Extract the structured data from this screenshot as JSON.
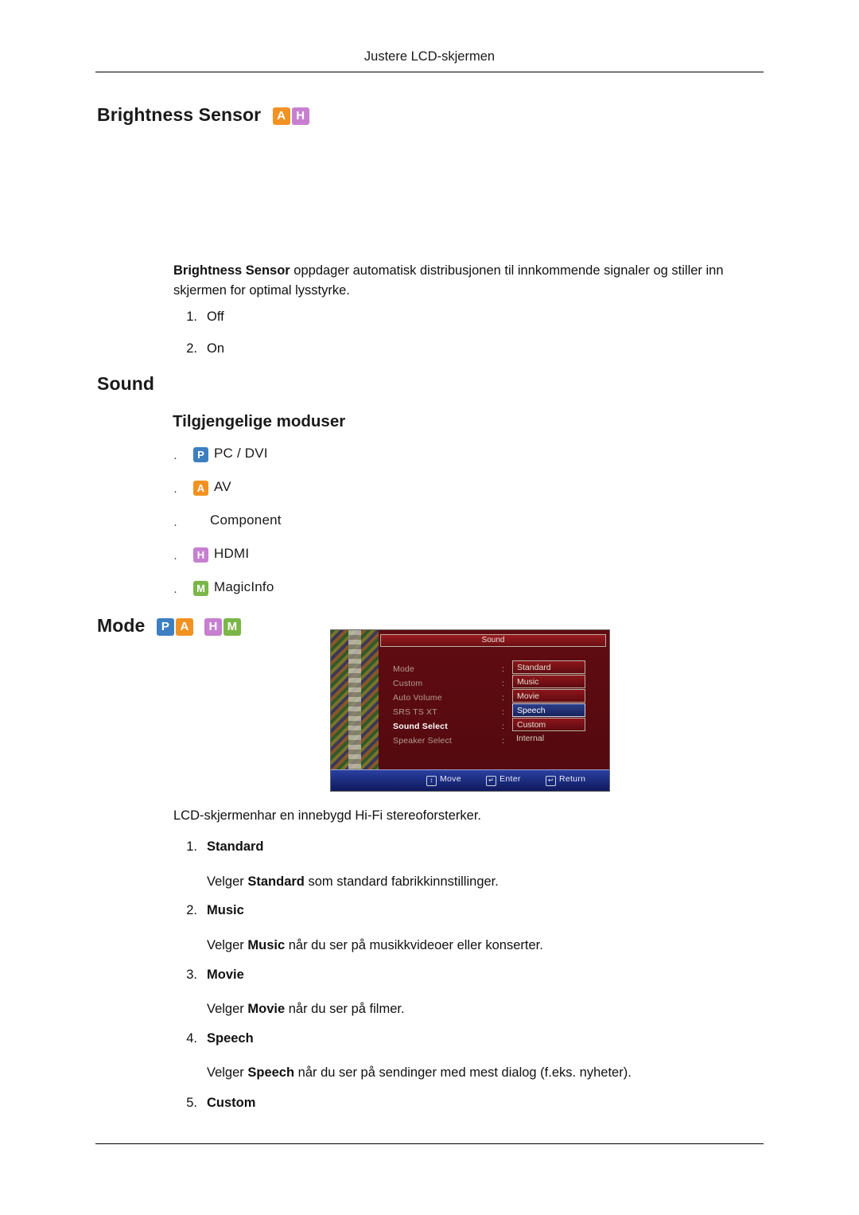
{
  "header": {
    "title": "Justere LCD-skjermen"
  },
  "sections": {
    "brightness_sensor": {
      "heading": "Brightness Sensor",
      "badges": [
        "A",
        "H"
      ],
      "paragraph_lead": "Brightness Sensor",
      "paragraph_rest": " oppdager automatisk distribusjonen til innkommende signaler og stiller inn skjermen for optimal lysstyrke.",
      "items": [
        {
          "index": "1.",
          "label": "Off"
        },
        {
          "index": "2.",
          "label": "On"
        }
      ]
    },
    "sound": {
      "heading": "Sound",
      "sub_heading": "Tilgjengelige moduser",
      "modes": [
        {
          "badges": [
            "P"
          ],
          "label": "PC / DVI"
        },
        {
          "badges": [
            "A"
          ],
          "label": "AV"
        },
        {
          "badges": [],
          "label": "Component"
        },
        {
          "badges": [
            "H"
          ],
          "label": "HDMI"
        },
        {
          "badges": [
            "M"
          ],
          "label": "MagicInfo"
        }
      ]
    },
    "mode": {
      "heading": "Mode",
      "badges": [
        "P",
        "A",
        "H",
        "M"
      ],
      "description": "LCD-skjermenhar en innebygd Hi-Fi stereoforsterker.",
      "items": [
        {
          "index": "1.",
          "label": "Standard",
          "desc_pre": "Velger ",
          "desc_bold": "Standard",
          "desc_post": " som standard fabrikkinnstillinger."
        },
        {
          "index": "2.",
          "label": "Music",
          "desc_pre": "Velger ",
          "desc_bold": "Music",
          "desc_post": " når du ser på musikkvideoer eller konserter."
        },
        {
          "index": "3.",
          "label": "Movie",
          "desc_pre": "Velger ",
          "desc_bold": "Movie",
          "desc_post": " når du ser på filmer."
        },
        {
          "index": "4.",
          "label": "Speech",
          "desc_pre": "Velger ",
          "desc_bold": "Speech",
          "desc_post": " når du ser på sendinger med mest dialog (f.eks. nyheter)."
        },
        {
          "index": "5.",
          "label": "Custom",
          "desc_pre": "",
          "desc_bold": "",
          "desc_post": ""
        }
      ]
    }
  },
  "osd": {
    "title": "Sound",
    "menu": [
      "Mode",
      "Custom",
      "Auto Volume",
      "SRS TS XT",
      "Sound Select",
      "Speaker Select"
    ],
    "values": [
      "Standard",
      "Music",
      "Movie",
      "Speech",
      "Custom"
    ],
    "last_value": "Internal",
    "selected_value": "Speech",
    "selected_menu": "Sound Select",
    "footer": [
      {
        "glyph": "↕",
        "label": "Move"
      },
      {
        "glyph": "↵",
        "label": "Enter"
      },
      {
        "glyph": "↩",
        "label": "Return"
      }
    ]
  },
  "colors": {
    "badge_a": "#f29222",
    "badge_h": "#c77fd0",
    "badge_p": "#3d7fc1",
    "badge_m": "#7ab648",
    "osd_bg": "#6d0d14",
    "osd_highlight": "#16235c"
  }
}
